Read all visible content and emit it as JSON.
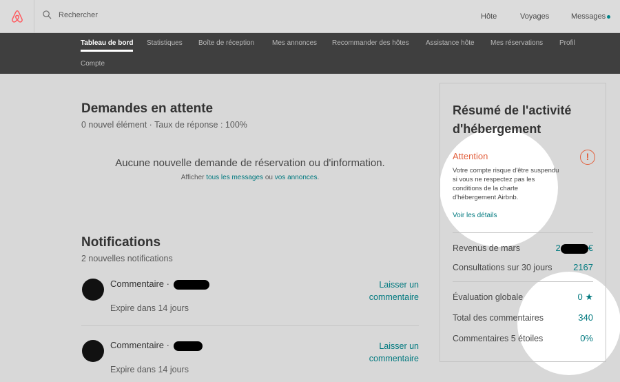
{
  "header": {
    "search_placeholder": "Rechercher",
    "nav": [
      "Hôte",
      "Voyages",
      "Messages"
    ]
  },
  "subnav": {
    "items": [
      "Tableau de bord",
      "Statistiques",
      "Boîte de réception",
      "Mes annonces",
      "Recommander des hôtes",
      "Assistance hôte",
      "Mes réservations",
      "Profil",
      "Compte"
    ]
  },
  "pending": {
    "title": "Demandes en attente",
    "subtitle": "0 nouvel élément · Taux de réponse : 100%",
    "empty_message": "Aucune nouvelle demande de réservation ou d'information.",
    "show_prefix": "Afficher ",
    "link_messages": "tous les messages",
    "or": " ou ",
    "link_listings": "vos annonces",
    "period": "."
  },
  "notifications": {
    "title": "Notifications",
    "subtitle": "2 nouvelles notifications",
    "items": [
      {
        "title": "Commentaire · ",
        "expire": "Expire dans 14 jours",
        "action": "Laisser un commentaire"
      },
      {
        "title": "Commentaire · ",
        "expire": "Expire dans 14 jours",
        "action": "Laisser un commentaire"
      }
    ]
  },
  "panel": {
    "title": "Résumé de l'activité d'hébergement",
    "attention_title": "Attention",
    "attention_icon": "!",
    "attention_body": "Votre compte risque d'être suspendu si vous ne respectez pas les conditions de la charte d'hébergement Airbnb.",
    "details_link": "Voir les détails",
    "stats": [
      {
        "label": "Revenus de mars",
        "value": "2",
        "value_suffix": "€"
      },
      {
        "label": "Consultations sur 30 jours",
        "value": "2167"
      },
      {
        "label": "Évaluation globale",
        "value": "0 ★"
      },
      {
        "label": "Total des commentaires",
        "value": "340"
      },
      {
        "label": "Commentaires 5 étoiles",
        "value": "0%"
      }
    ]
  },
  "colors": {
    "brand": "#ff5a5f",
    "accent": "#00797f",
    "warning": "#e25f3c",
    "subnav_bg": "#3f3f3f"
  }
}
